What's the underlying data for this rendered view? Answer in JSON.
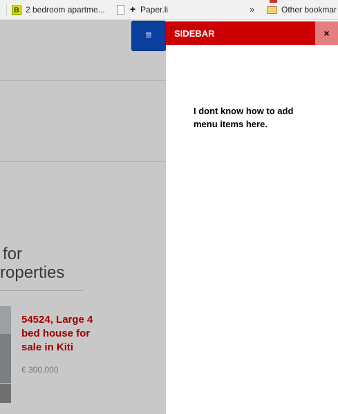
{
  "bookmarks_bar": {
    "items": [
      {
        "label": "2 bedroom apartme...",
        "icon": "b-site-icon"
      },
      {
        "label": "",
        "icon": "page-icon"
      },
      {
        "label": "Paper.li",
        "icon": "plus-icon"
      }
    ],
    "overflow": "»",
    "other_label": "Other bookmar"
  },
  "page": {
    "heading_line1": "for",
    "heading_line2": "roperties",
    "listing": {
      "title": "54524, Large 4 bed house for sale in Kiti",
      "price": "€ 300,000"
    }
  },
  "menu_button": {
    "glyph": "≡"
  },
  "sidebar": {
    "title": "SIDEBAR",
    "close": "×",
    "text": "I dont know how to add menu items here."
  },
  "colors": {
    "sidebar_header": "#cc0000",
    "close_button": "#e57e7e",
    "menu_button": "#0a3f9e",
    "listing_title": "#a00000"
  }
}
